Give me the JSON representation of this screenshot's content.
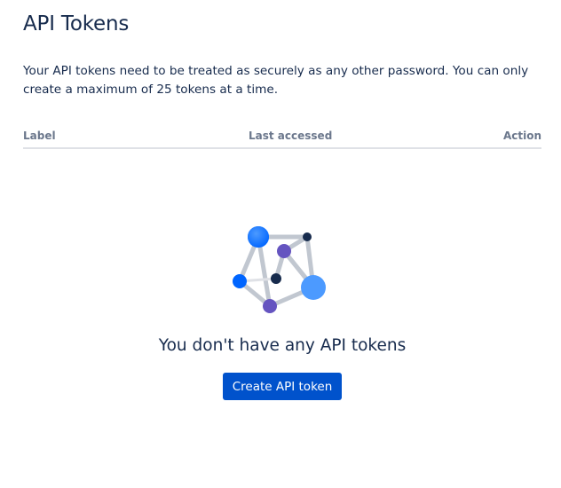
{
  "header": {
    "title": "API Tokens"
  },
  "description": "Your API tokens need to be treated as securely as any other password. You can only create a maximum of 25 tokens at a time.",
  "table": {
    "columns": [
      "Label",
      "Last accessed",
      "Action"
    ],
    "rows": []
  },
  "empty_state": {
    "illustration": "network-graph-illustration",
    "title": "You don't have any API tokens",
    "button_label": "Create API token"
  },
  "colors": {
    "primary_button": "#0052CC",
    "text": "#172B4D",
    "subtle_text": "#6B778C",
    "divider": "#DFE1E6"
  }
}
